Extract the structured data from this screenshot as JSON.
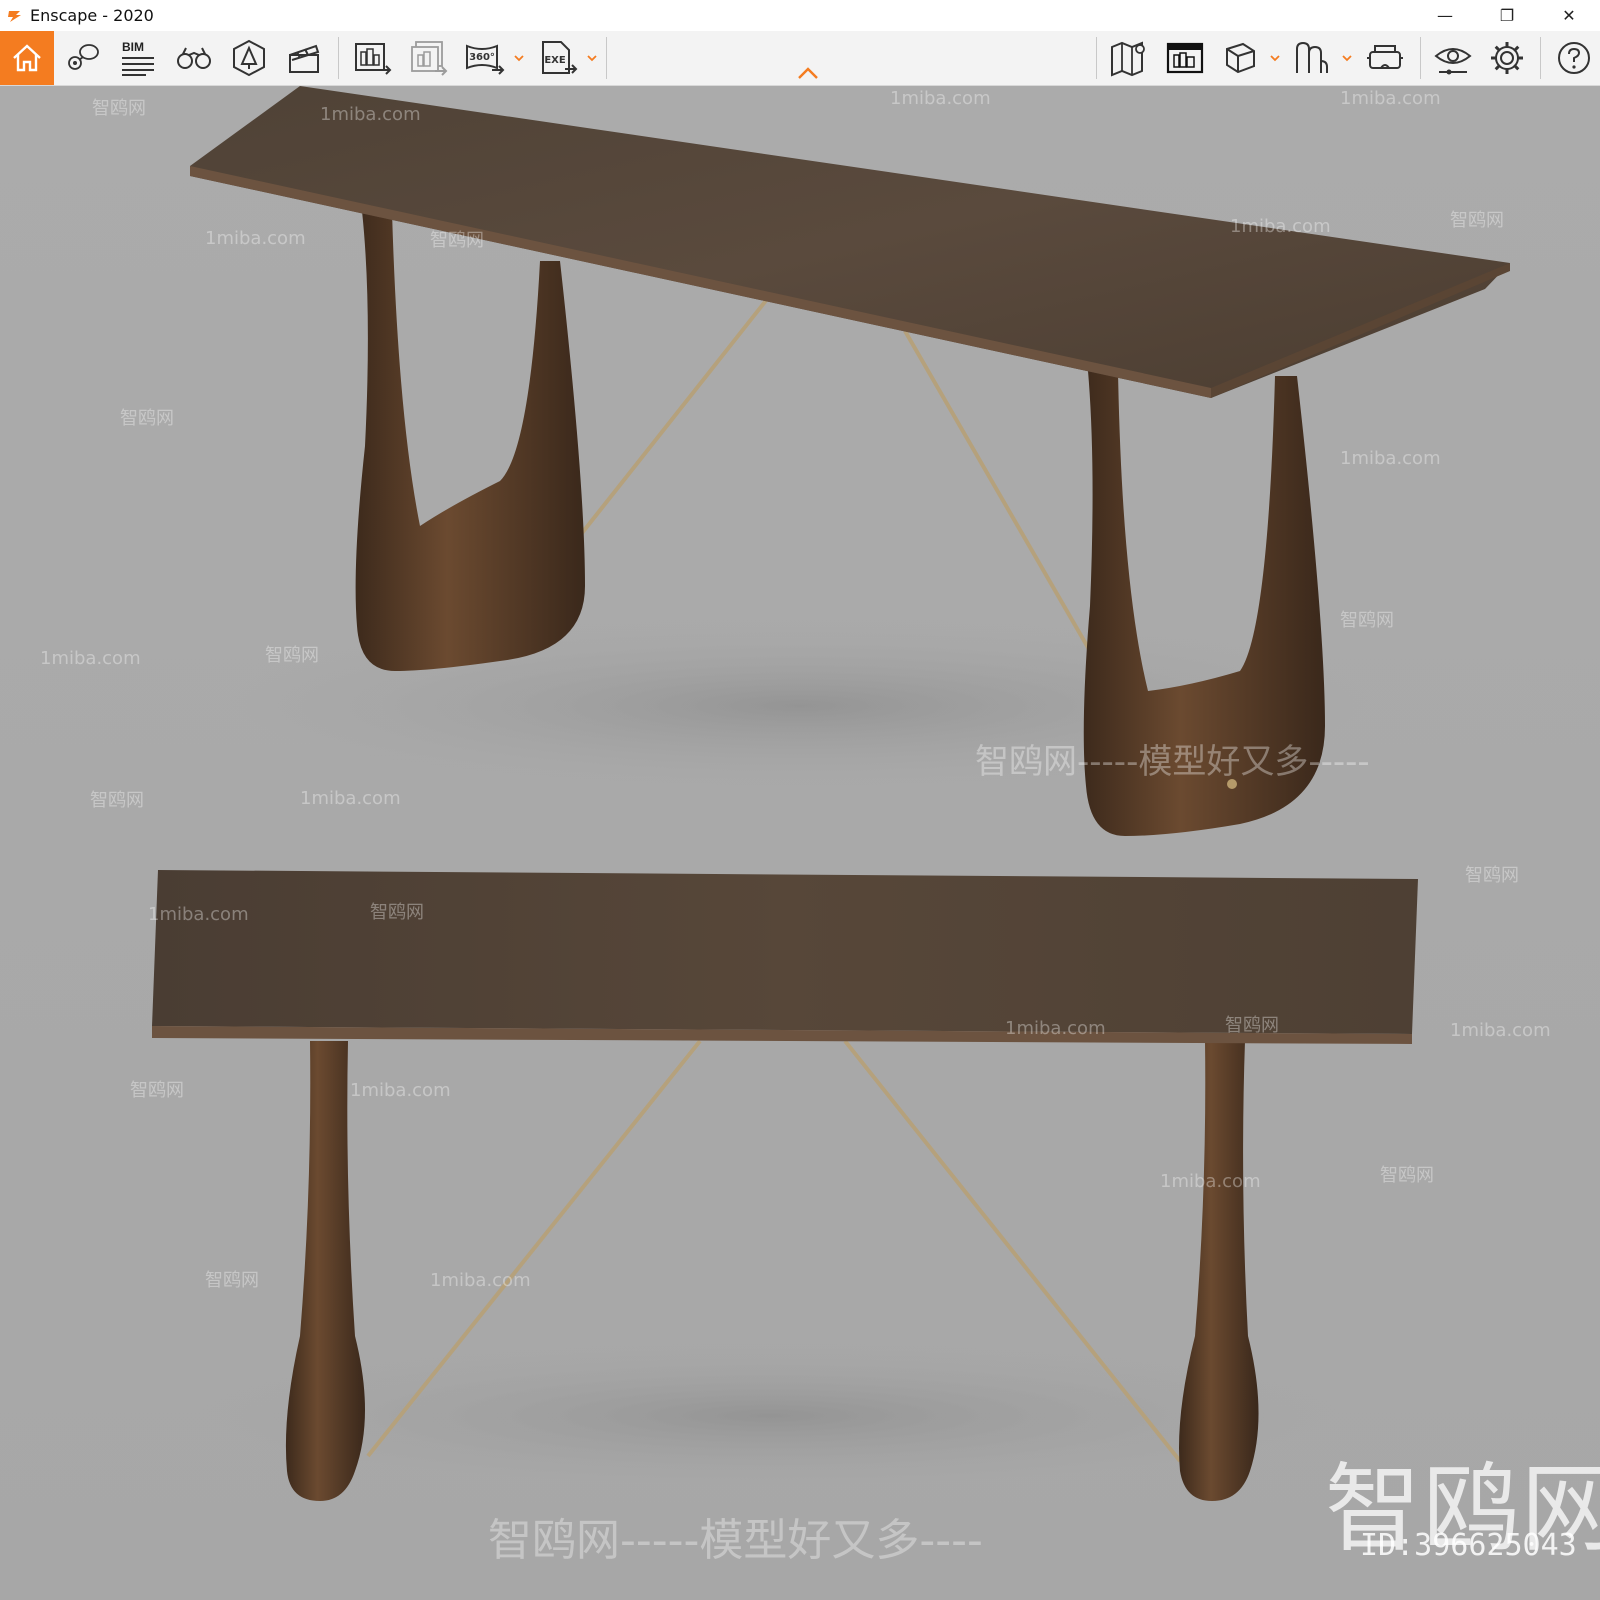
{
  "window": {
    "title": "Enscape - 2020",
    "minimize_glyph": "—",
    "restore_glyph": "❐",
    "close_glyph": "✕"
  },
  "toolbar": {
    "accent_color": "#f47c20",
    "bim_label": "BIM",
    "tools_left": [
      {
        "name": "home-icon"
      },
      {
        "name": "views-icon"
      },
      {
        "name": "bim-icon"
      },
      {
        "name": "binoculars-icon"
      },
      {
        "name": "asset-library-icon"
      },
      {
        "name": "video-editor-icon"
      },
      {
        "name": "screenshot-icon"
      },
      {
        "name": "batch-render-icon"
      },
      {
        "name": "panorama-360-icon"
      },
      {
        "name": "export-exe-icon"
      }
    ],
    "tools_right": [
      {
        "name": "map-icon"
      },
      {
        "name": "render-preview-icon"
      },
      {
        "name": "cube-icon"
      },
      {
        "name": "materials-icon"
      },
      {
        "name": "vr-headset-icon"
      },
      {
        "name": "visual-settings-icon"
      },
      {
        "name": "settings-gear-icon"
      },
      {
        "name": "help-icon"
      }
    ],
    "label_360": "360°",
    "label_exe": "EXE"
  },
  "viewport": {
    "watermark_small": [
      "1miba.com",
      "智鸥网"
    ],
    "watermark_slogan": "智鸥网-----模型好又多----",
    "watermark_slogan_mid": "智鸥网-----模型好又多-----",
    "watermark_brand": "智鸥网",
    "watermark_id": "ID:396625043"
  }
}
